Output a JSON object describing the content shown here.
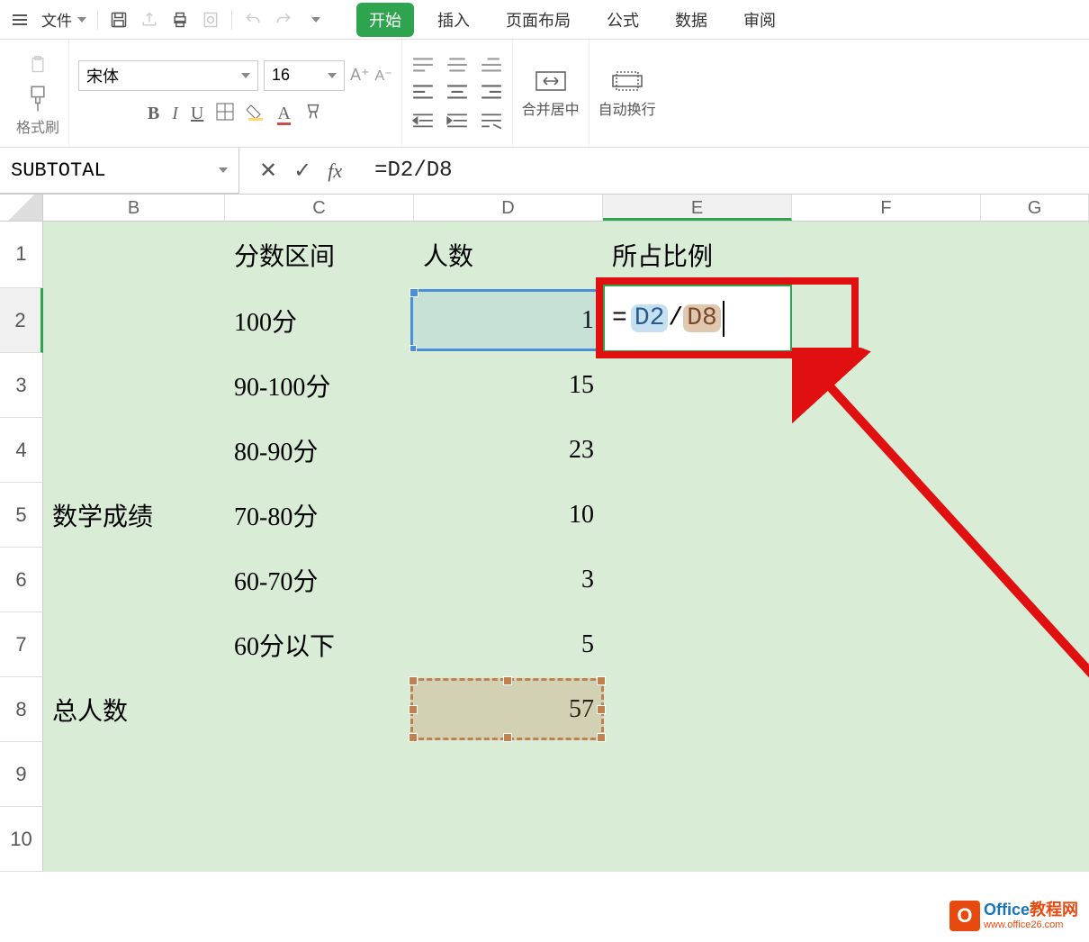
{
  "appbar": {
    "file_label": "文件",
    "tabs": [
      "开始",
      "插入",
      "页面布局",
      "公式",
      "数据",
      "审阅"
    ]
  },
  "ribbon": {
    "format_painter": "格式刷",
    "font_name": "宋体",
    "font_size": "16",
    "merge_label": "合并居中",
    "wrap_label": "自动换行"
  },
  "formula_bar": {
    "name_box": "SUBTOTAL",
    "formula": "=D2/D8",
    "cell_formula_eq": "=",
    "cell_formula_ref1": "D2",
    "cell_formula_slash": " / ",
    "cell_formula_ref2": "D8"
  },
  "columns": [
    "B",
    "C",
    "D",
    "E",
    "F",
    "G"
  ],
  "row_numbers": [
    "1",
    "2",
    "3",
    "4",
    "5",
    "6",
    "7",
    "8",
    "9",
    "10"
  ],
  "cells": {
    "C1": "分数区间",
    "D1": "人数",
    "E1": "所占比例",
    "C2": "100分",
    "D2": "1",
    "C3": "90-100分",
    "D3": "15",
    "C4": "80-90分",
    "D4": "23",
    "B5": "数学成绩",
    "C5": "70-80分",
    "D5": "10",
    "C6": "60-70分",
    "D6": "3",
    "C7": "60分以下",
    "D7": "5",
    "B8": "总人数",
    "D8": "57"
  },
  "watermark": {
    "logo_letter": "O",
    "line1a": "Office",
    "line1b": "教程网",
    "line2": "www.office26.com"
  }
}
